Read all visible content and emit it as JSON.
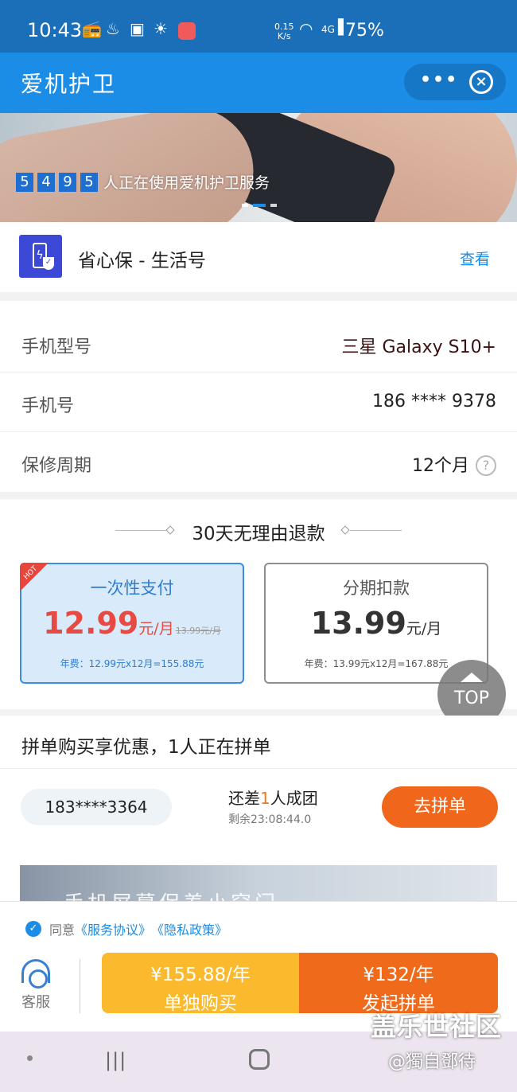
{
  "status_bar": {
    "time": "10:43",
    "net_speed_value": "0.15",
    "net_speed_unit": "K/s",
    "battery": "75%",
    "signal_label": "4G"
  },
  "header": {
    "title": "爱机护卫",
    "more": "•••",
    "close": "⊗"
  },
  "banner": {
    "digits": [
      "5",
      "4",
      "9",
      "5"
    ],
    "text": "人正在使用爱机护卫服务",
    "active_slide": 2,
    "slide_count": 3
  },
  "life_account": {
    "name": "省心保 - 生活号",
    "view_label": "查看"
  },
  "info": {
    "model_label": "手机型号",
    "model_value": "三星 Galaxy S10+",
    "phone_label": "手机号",
    "phone_value": "186 **** 9378",
    "period_label": "保修周期",
    "period_value": "12个月",
    "help": "?"
  },
  "plans": {
    "heading": "30天无理由退款",
    "hot": "HOT",
    "onetime": {
      "name": "一次性支付",
      "price": "12.99",
      "unit": "元/月",
      "original": "13.99元/月",
      "annual": "年费：12.99元x12月=155.88元"
    },
    "installment": {
      "name": "分期扣款",
      "price": "13.99",
      "unit": "元/月",
      "annual": "年费：13.99元x12月=167.88元"
    }
  },
  "top_button": "TOP",
  "group_buy": {
    "title": "拼单购买享优惠，1人正在拼单",
    "member_phone": "183****3364",
    "need_prefix": "还差",
    "need_count": "1",
    "need_suffix": "人成团",
    "remaining": "剩余23:08:44.0",
    "join_label": "去拼单",
    "image_text": "手机屏幕保养小窍门"
  },
  "footer": {
    "agree_prefix": "同意",
    "service_agreement": "《服务协议》",
    "privacy_policy": "《隐私政策》",
    "customer_service": "客服",
    "single_price": "¥155.88/年",
    "single_label": "单独购买",
    "team_price": "¥132/年",
    "team_label": "发起拼单"
  },
  "watermark": {
    "line1": "盖乐世社区",
    "line2": "@獨自鄧待"
  },
  "colors": {
    "status_bar": "#1a6fb8",
    "header": "#1b8de6",
    "accent_red": "#e84a43",
    "orange": "#ef6a1a",
    "yellow": "#fbb92e"
  }
}
